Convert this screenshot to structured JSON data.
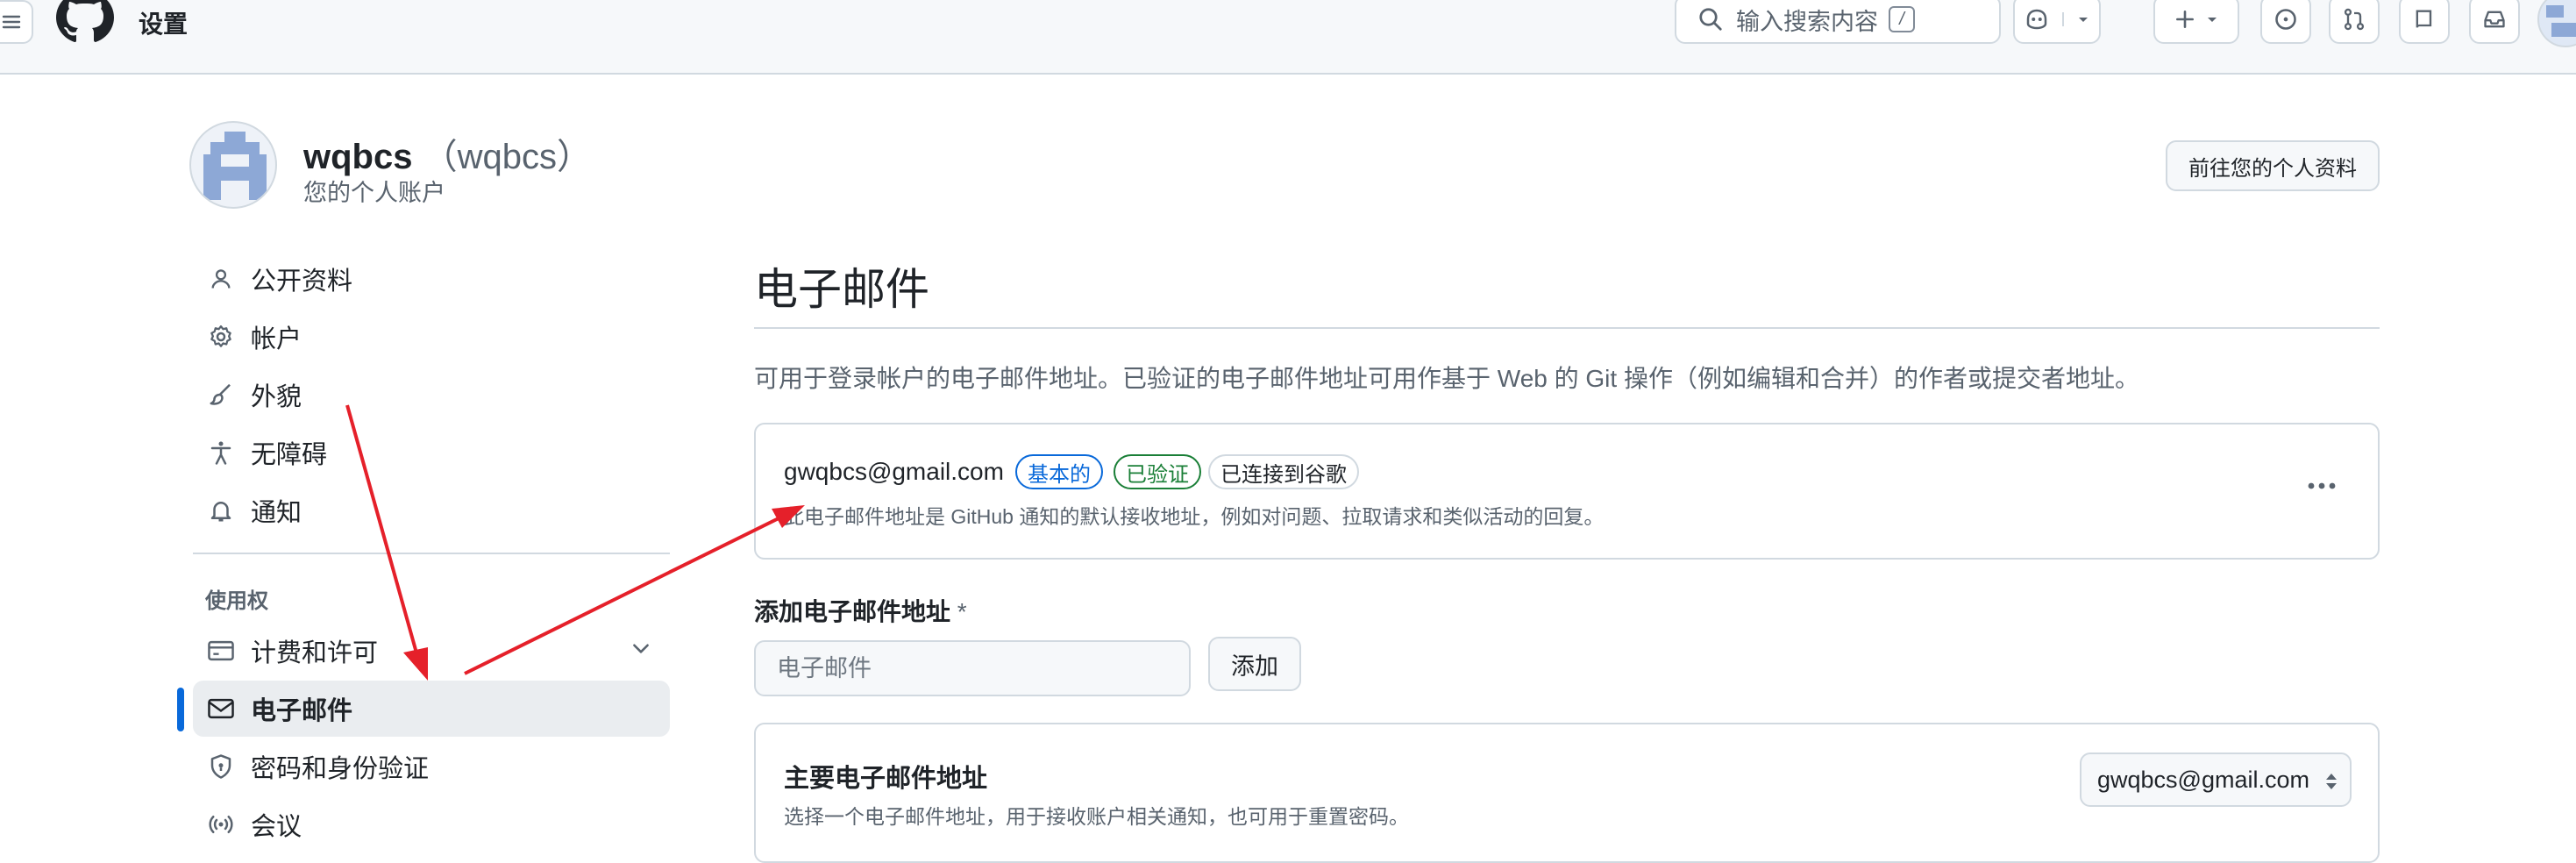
{
  "header": {
    "title": "设置",
    "search_placeholder": "输入搜索内容",
    "search_shortcut": "/"
  },
  "profile": {
    "login": "wqbcs",
    "name_paren": "（wqbcs）",
    "subtitle": "您的个人账户",
    "goto_button": "前往您的个人资料"
  },
  "sidebar": {
    "items": [
      {
        "label": "公开资料",
        "icon": "person-icon"
      },
      {
        "label": "帐户",
        "icon": "gear-icon"
      },
      {
        "label": "外貌",
        "icon": "paintbrush-icon"
      },
      {
        "label": "无障碍",
        "icon": "accessibility-icon"
      },
      {
        "label": "通知",
        "icon": "bell-icon"
      }
    ],
    "group_label": "使用权",
    "access_items": [
      {
        "label": "计费和许可",
        "icon": "credit-card-icon"
      },
      {
        "label": "电子邮件",
        "icon": "mail-icon",
        "active": true
      },
      {
        "label": "密码和身份验证",
        "icon": "shield-lock-icon"
      },
      {
        "label": "会议",
        "icon": "broadcast-icon"
      }
    ]
  },
  "main": {
    "title": "电子邮件",
    "description": "可用于登录帐户的电子邮件地址。已验证的电子邮件地址可用作基于 Web 的 Git 操作（例如编辑和合并）的作者或提交者地址。",
    "email_entry": {
      "address": "gwqbcs@gmail.com",
      "badges": [
        "基本的",
        "已验证",
        "已连接到谷歌"
      ],
      "note": "此电子邮件地址是 GitHub 通知的默认接收地址，例如对问题、拉取请求和类似活动的回复。"
    },
    "add_email": {
      "label": "添加电子邮件地址",
      "required_marker": "*",
      "placeholder": "电子邮件",
      "button": "添加"
    },
    "primary": {
      "title": "主要电子邮件地址",
      "note": "选择一个电子邮件地址，用于接收账户相关通知，也可用于重置密码。",
      "selected": "gwqbcs@gmail.com"
    }
  },
  "colors": {
    "accent": "#0969da",
    "success": "#1a7f37",
    "annotation_arrow": "#e5202a"
  }
}
